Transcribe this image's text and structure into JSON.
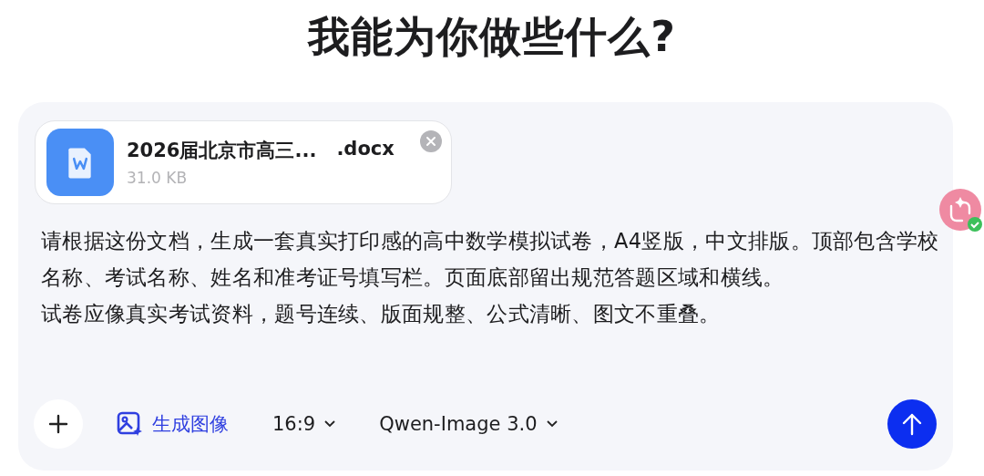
{
  "heading": "我能为你做些什么?",
  "attachment": {
    "name_start": "2026届北京市高三...",
    "name_end": ".docx",
    "size": "31.0 KB"
  },
  "prompt": [
    "请根据这份文档，生成一套真实打印感的高中数学模拟试卷，A4竖版，中文排版。顶部包含学校名称、考试名称、姓名和准考证号填写栏。页面底部留出规范答题区域和横线。",
    "试卷应像真实考试资料，题号连续、版面规整、公式清晰、图文不重叠。"
  ],
  "toolbar": {
    "mode": {
      "label": "生成图像",
      "on": true
    },
    "ratio": "16:9",
    "model": "Qwen-Image 3.0"
  }
}
